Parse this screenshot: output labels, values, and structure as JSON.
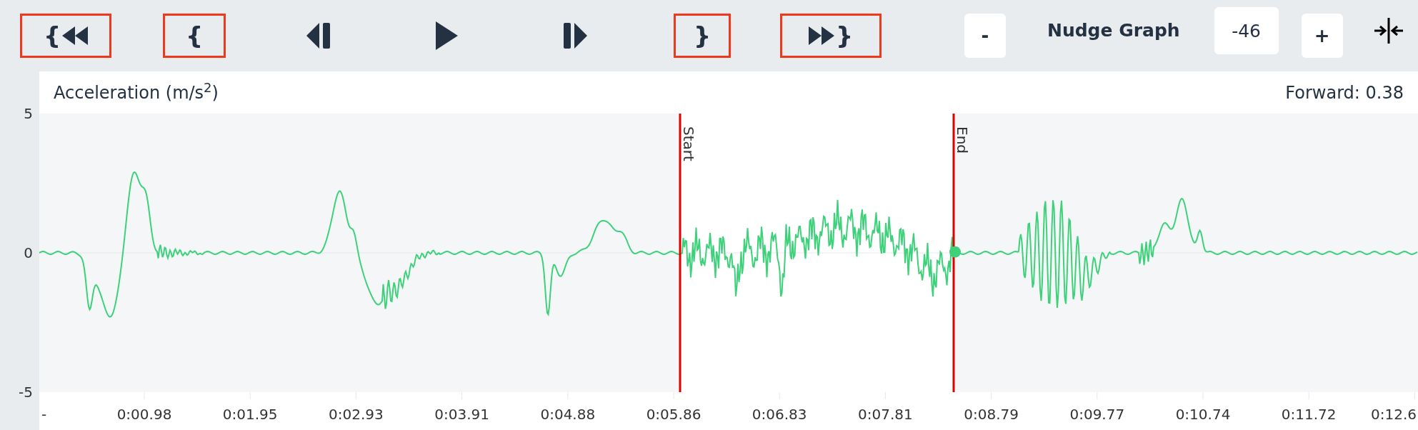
{
  "toolbar": {
    "buttons": [
      {
        "kind": "rewind-start",
        "label": "{",
        "outlined": true
      },
      {
        "kind": "brace",
        "label": "{",
        "outlined": true
      },
      {
        "kind": "step-back",
        "outlined": false
      },
      {
        "kind": "play",
        "outlined": false
      },
      {
        "kind": "step-forward",
        "outlined": false
      },
      {
        "kind": "brace",
        "label": "}",
        "outlined": true
      },
      {
        "kind": "forward-end",
        "label": "}",
        "outlined": true
      }
    ],
    "nudge": {
      "minus": "-",
      "label": "Nudge Graph",
      "value": "-46",
      "plus": "+"
    }
  },
  "graph": {
    "title": "Acceleration (m/s$^{2}$)",
    "reading": "Forward: 0.38",
    "y_ticks": [
      "5",
      "0",
      "-5"
    ],
    "x_ticks": [
      "-",
      "0:00.98",
      "0:01.95",
      "0:02.93",
      "0:03.91",
      "0:04.88",
      "0:05.86",
      "0:06.83",
      "0:07.81",
      "0:08.79",
      "0:09.77",
      "0:10.74",
      "0:11.72",
      "0:12.6"
    ],
    "selection": {
      "start_label": "Start",
      "end_label": "End"
    }
  }
}
